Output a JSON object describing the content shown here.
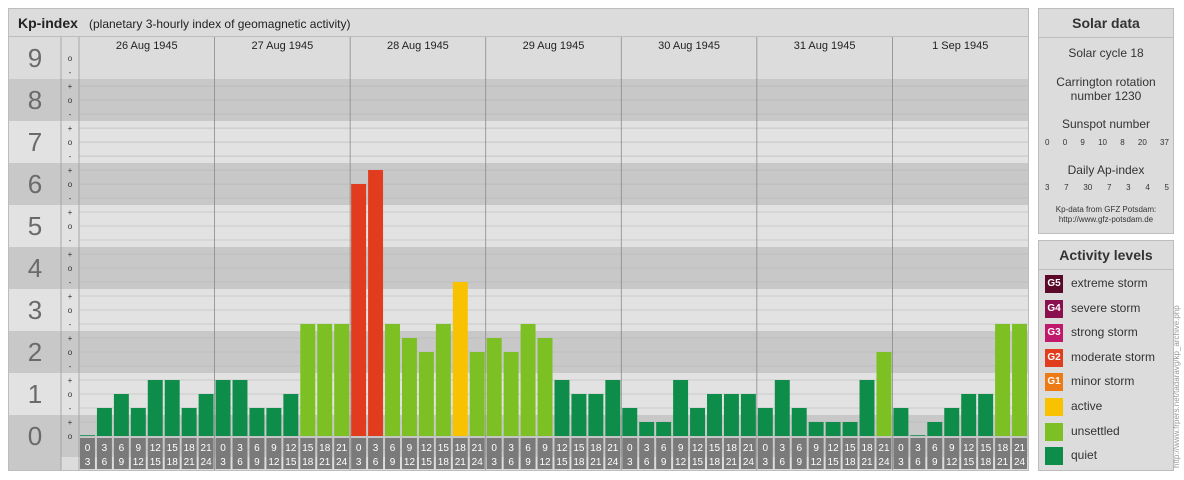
{
  "header": {
    "title": "Kp-index",
    "subtitle": "(planetary 3-hourly index of geomagnetic activity)"
  },
  "solar": {
    "title": "Solar data",
    "solar_cycle": "Solar cycle 18",
    "carrington_line1": "Carrington rotation",
    "carrington_line2": "number 1230",
    "sunspot_title": "Sunspot number",
    "sunspot_values": [
      "0",
      "0",
      "9",
      "10",
      "8",
      "20",
      "37"
    ],
    "ap_title": "Daily Ap-index",
    "ap_values": [
      "3",
      "7",
      "30",
      "7",
      "3",
      "4",
      "5"
    ],
    "source_line1": "Kp-data from GFZ Potsdam:",
    "source_line2": "http://www.gfz-potsdam.de"
  },
  "legend": {
    "title": "Activity levels",
    "items": [
      {
        "code": "G5",
        "label": "extreme storm",
        "color": "#5a0a28"
      },
      {
        "code": "G4",
        "label": "severe storm",
        "color": "#8a0f4e"
      },
      {
        "code": "G3",
        "label": "strong storm",
        "color": "#c0186a"
      },
      {
        "code": "G2",
        "label": "moderate storm",
        "color": "#e23c1e"
      },
      {
        "code": "G1",
        "label": "minor storm",
        "color": "#ee7a16"
      },
      {
        "code": "",
        "label": "active",
        "color": "#f9c200"
      },
      {
        "code": "",
        "label": "unsettled",
        "color": "#7cc023"
      },
      {
        "code": "",
        "label": "quiet",
        "color": "#0e8c4a"
      }
    ]
  },
  "credit": "http://www.frpers.net/tadaravg/kp_archive.php",
  "chart_data": {
    "type": "bar",
    "ylim": [
      0,
      9
    ],
    "y_ticks": [
      "0",
      "1",
      "2",
      "3",
      "4",
      "5",
      "6",
      "7",
      "8",
      "9"
    ],
    "y_subticks": [
      "-",
      "o",
      "+"
    ],
    "days": [
      "26 Aug 1945",
      "27 Aug 1945",
      "28 Aug 1945",
      "29 Aug 1945",
      "30 Aug 1945",
      "31 Aug 1945",
      "1 Sep 1945"
    ],
    "interval_starts": [
      "0",
      "3",
      "6",
      "9",
      "12",
      "15",
      "18",
      "21"
    ],
    "interval_ends": [
      "3",
      "6",
      "9",
      "12",
      "15",
      "18",
      "21",
      "24"
    ],
    "values": [
      0,
      0.667,
      1,
      0.667,
      1.333,
      1.333,
      0.667,
      1,
      1.333,
      1.333,
      0.667,
      0.667,
      1,
      2.667,
      2.667,
      2.667,
      6,
      6.333,
      2.667,
      2.333,
      2,
      2.667,
      3.667,
      2,
      2.333,
      2,
      2.667,
      2.333,
      1.333,
      1,
      1,
      1.333,
      0.667,
      0.333,
      0.333,
      1.333,
      0.667,
      1,
      1,
      1,
      0.667,
      1.333,
      0.667,
      0.333,
      0.333,
      0.333,
      1.333,
      2,
      0.667,
      0,
      0.333,
      0.667,
      1,
      1,
      2.667,
      2.667
    ],
    "colors": {
      "quiet": "#0e8c4a",
      "unsettled": "#7cc023",
      "active": "#f9c200",
      "minor_storm": "#ee7a16",
      "moderate_storm": "#e23c1e",
      "strong_storm": "#c0186a",
      "severe_storm": "#8a0f4e",
      "extreme_storm": "#5a0a28",
      "band_dark": "#c8c8c8",
      "band_light": "#e2e2e2",
      "label_bg": "#7a7a7a"
    }
  }
}
